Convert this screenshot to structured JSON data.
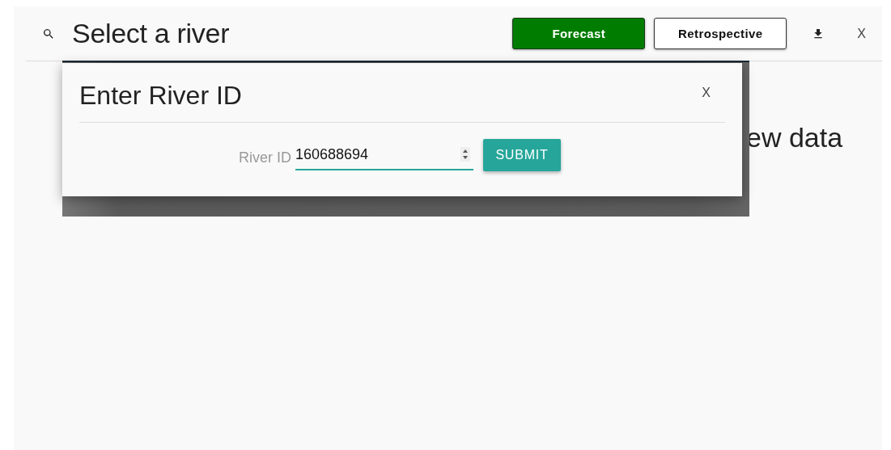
{
  "header": {
    "title": "Select a river",
    "modes": [
      {
        "label": "Forecast",
        "selected": true
      },
      {
        "label": "Retrospective",
        "selected": false
      }
    ],
    "close": "X"
  },
  "background_text": [
    "ew data"
  ],
  "dialog": {
    "title": "Enter River ID",
    "close": "X",
    "field": {
      "label": "River ID",
      "value": "160688694"
    },
    "submit": "SUBMIT"
  }
}
